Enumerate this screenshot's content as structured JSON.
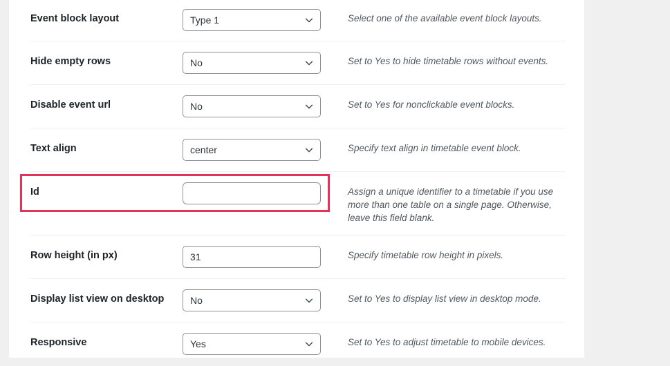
{
  "colors": {
    "page_background": "#f0f0f1",
    "panel_background": "#ffffff",
    "label_text": "#1d2327",
    "description_text": "#50575e",
    "control_border": "#8c8f94",
    "row_divider": "#f0f0f1",
    "highlight_outline": "#e5325b"
  },
  "highlight": {
    "target_row": "Id",
    "style": "rectangle-outline"
  },
  "settings_rows": [
    {
      "label": "Event block layout",
      "control": "select",
      "value": "Type 1",
      "icon": "chevron-down-icon",
      "description": "Select one of the available event block layouts."
    },
    {
      "label": "Hide empty rows",
      "control": "select",
      "value": "No",
      "icon": "chevron-down-icon",
      "description": "Set to Yes to hide timetable rows without events."
    },
    {
      "label": "Disable event url",
      "control": "select",
      "value": "No",
      "icon": "chevron-down-icon",
      "description": "Set to Yes for nonclickable event blocks."
    },
    {
      "label": "Text align",
      "control": "select",
      "value": "center",
      "icon": "chevron-down-icon",
      "description": "Specify text align in timetable event block."
    },
    {
      "label": "Id",
      "control": "text",
      "value": "",
      "placeholder": "",
      "description": "Assign a unique identifier to a timetable if you use more than one table on a single page. Otherwise, leave this field blank."
    },
    {
      "label": "Row height (in px)",
      "control": "text",
      "value": "31",
      "placeholder": "",
      "description": "Specify timetable row height in pixels."
    },
    {
      "label": "Display list view on desktop",
      "control": "select",
      "value": "No",
      "icon": "chevron-down-icon",
      "description": "Set to Yes to display list view in desktop mode."
    },
    {
      "label": "Responsive",
      "control": "select",
      "value": "Yes",
      "icon": "chevron-down-icon",
      "description": "Set to Yes to adjust timetable to mobile devices."
    }
  ]
}
